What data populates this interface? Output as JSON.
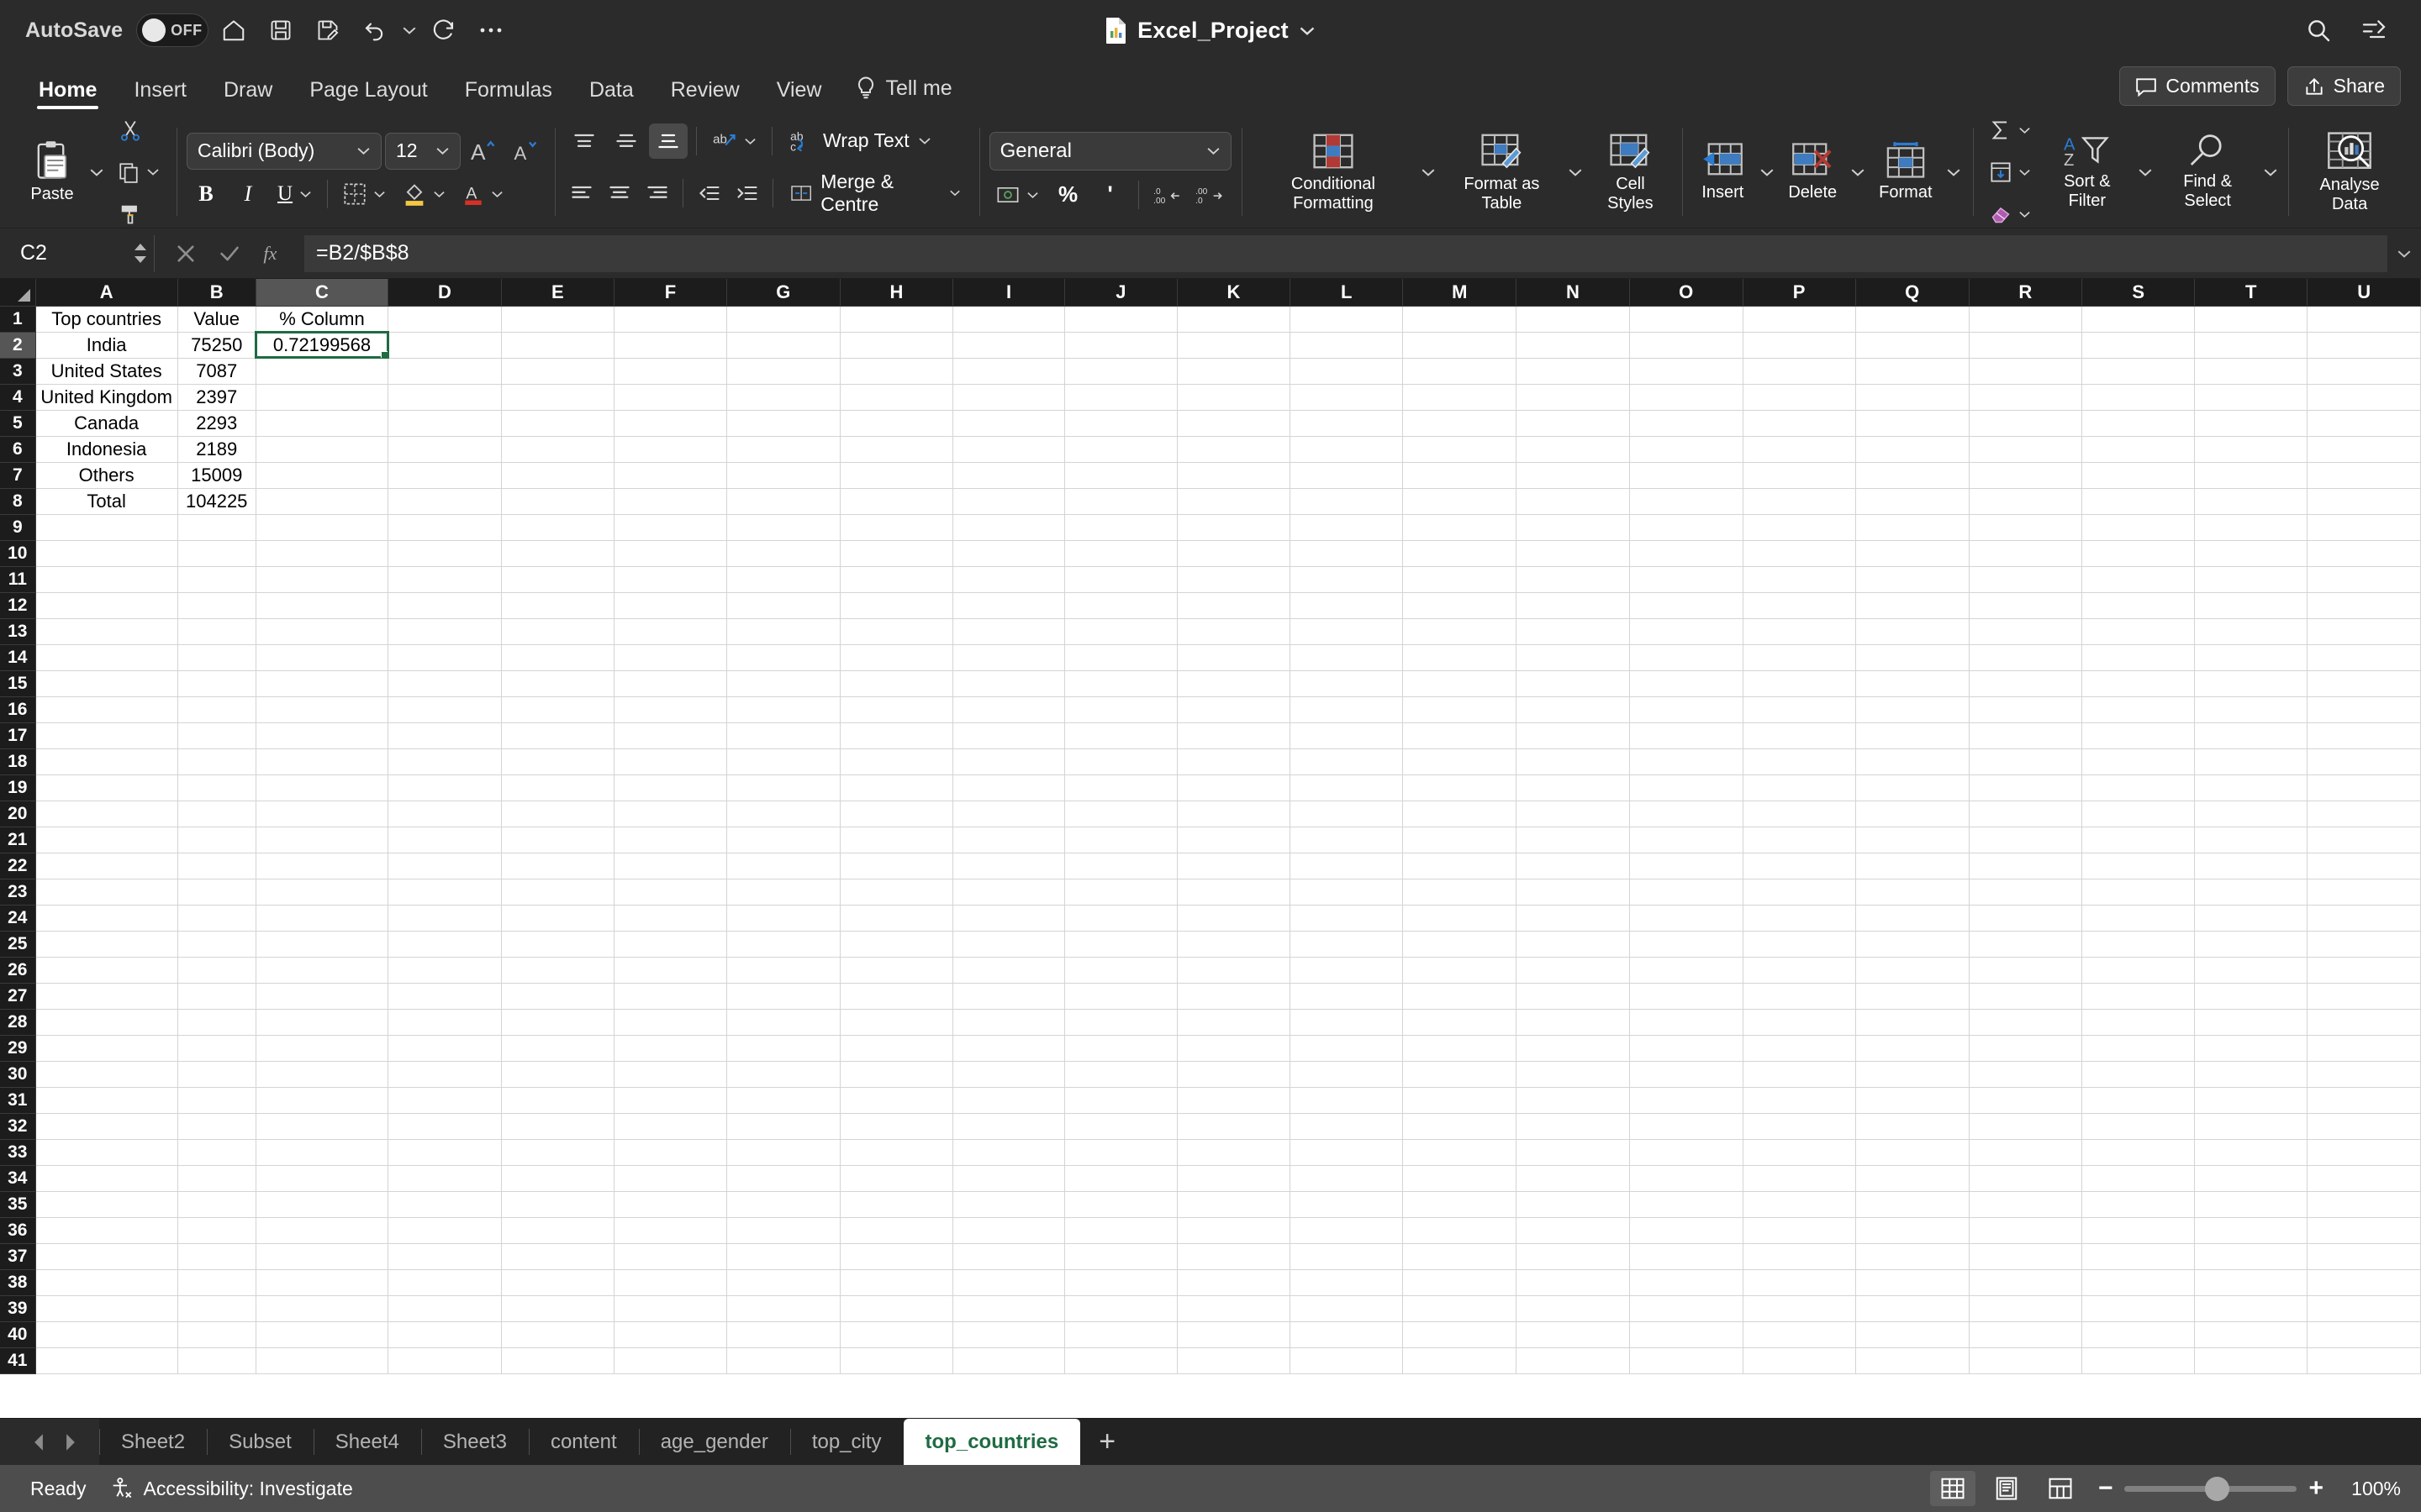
{
  "titlebar": {
    "autosave_label": "AutoSave",
    "autosave_state": "OFF",
    "document_title": "Excel_Project",
    "icons": [
      "home-icon",
      "save-icon",
      "save-as-icon",
      "undo-icon",
      "redo-icon",
      "more-icon",
      "search-icon",
      "ribbon-display-icon"
    ]
  },
  "tabs": [
    {
      "label": "Home",
      "active": true
    },
    {
      "label": "Insert",
      "active": false
    },
    {
      "label": "Draw",
      "active": false
    },
    {
      "label": "Page Layout",
      "active": false
    },
    {
      "label": "Formulas",
      "active": false
    },
    {
      "label": "Data",
      "active": false
    },
    {
      "label": "Review",
      "active": false
    },
    {
      "label": "View",
      "active": false
    }
  ],
  "tellme_label": "Tell me",
  "comments_label": "Comments",
  "share_label": "Share",
  "ribbon": {
    "clipboard": {
      "paste_label": "Paste",
      "cut_icon": "scissors-icon",
      "copy_icon": "copy-icon",
      "format_painter_icon": "paintbrush-icon"
    },
    "font": {
      "font_name": "Calibri (Body)",
      "font_size": "12",
      "grow_font_label": "A",
      "shrink_font_label": "A",
      "bold_label": "B",
      "italic_label": "I",
      "underline_label": "U",
      "borders_icon": "borders-icon",
      "fill_color_icon": "fill-color-icon",
      "font_color_icon": "font-color-icon"
    },
    "alignment": {
      "wrap_text_label": "Wrap Text",
      "merge_label": "Merge & Centre",
      "orientation_icon": "orientation-icon",
      "align_top_icon": "align-top-icon",
      "align_middle_icon": "align-middle-icon",
      "align_bottom_icon": "align-bottom-icon",
      "align_left_icon": "align-left-icon",
      "align_center_icon": "align-center-icon",
      "align_right_icon": "align-right-icon",
      "decrease_indent_icon": "decrease-indent-icon",
      "increase_indent_icon": "increase-indent-icon"
    },
    "number": {
      "format": "General",
      "accounting_icon": "accounting-format-icon",
      "percent_label": "%",
      "comma_label": "'",
      "increase_decimal_label": "←.00",
      "decrease_decimal_label": ".00→"
    },
    "styles": [
      {
        "label": "Conditional Formatting",
        "icon": "conditional-formatting-icon"
      },
      {
        "label": "Format as Table",
        "icon": "format-as-table-icon"
      },
      {
        "label": "Cell Styles",
        "icon": "cell-styles-icon"
      }
    ],
    "cells": [
      {
        "label": "Insert",
        "icon": "insert-cells-icon"
      },
      {
        "label": "Delete",
        "icon": "delete-cells-icon"
      },
      {
        "label": "Format",
        "icon": "format-cells-icon"
      }
    ],
    "editing": {
      "autosum_icon": "sigma-icon",
      "fill_icon": "fill-down-icon",
      "clear_icon": "eraser-icon",
      "sort_filter_label": "Sort & Filter",
      "find_select_label": "Find & Select"
    },
    "analysis": {
      "label": "Analyse Data",
      "icon": "analyse-data-icon"
    }
  },
  "formula_bar": {
    "name_box": "C2",
    "cancel_icon": "cancel-icon",
    "enter_icon": "confirm-icon",
    "function_icon": "fx-icon",
    "formula": "=B2/$B$8"
  },
  "grid": {
    "columns": [
      "A",
      "B",
      "C",
      "D",
      "E",
      "F",
      "G",
      "H",
      "I",
      "J",
      "K",
      "L",
      "M",
      "N",
      "O",
      "P",
      "Q",
      "R",
      "S",
      "T",
      "U"
    ],
    "selected_column": "C",
    "selected_row": 2,
    "selected_cell": "C2",
    "row_count": 41,
    "data": [
      {
        "row": 1,
        "A": "Top countries",
        "B": "Value",
        "C": "% Column"
      },
      {
        "row": 2,
        "A": "India",
        "B": "75250",
        "C": "0.72199568"
      },
      {
        "row": 3,
        "A": "United States",
        "B": "7087",
        "C": ""
      },
      {
        "row": 4,
        "A": "United Kingdom",
        "B": "2397",
        "C": ""
      },
      {
        "row": 5,
        "A": "Canada",
        "B": "2293",
        "C": ""
      },
      {
        "row": 6,
        "A": "Indonesia",
        "B": "2189",
        "C": ""
      },
      {
        "row": 7,
        "A": "Others",
        "B": "15009",
        "C": ""
      },
      {
        "row": 8,
        "A": "Total",
        "B": "104225",
        "C": ""
      }
    ]
  },
  "sheet_tabs": [
    {
      "label": "Sheet2",
      "active": false
    },
    {
      "label": "Subset",
      "active": false
    },
    {
      "label": "Sheet4",
      "active": false
    },
    {
      "label": "Sheet3",
      "active": false
    },
    {
      "label": "content",
      "active": false
    },
    {
      "label": "age_gender",
      "active": false
    },
    {
      "label": "top_city",
      "active": false
    },
    {
      "label": "top_countries",
      "active": true
    }
  ],
  "add_sheet_label": "+",
  "statusbar": {
    "state": "Ready",
    "accessibility": "Accessibility: Investigate",
    "zoom": "100%",
    "zoom_out_label": "−",
    "zoom_in_label": "+",
    "views": [
      "normal-view-icon",
      "page-layout-view-icon",
      "page-break-view-icon"
    ]
  },
  "colors": {
    "chrome": "#2b2b2b",
    "grid_bg": "#ffffff",
    "selection_green": "#1f6b42",
    "accent_blue": "#2b7cd3",
    "statusbar": "#4d4d4d"
  }
}
